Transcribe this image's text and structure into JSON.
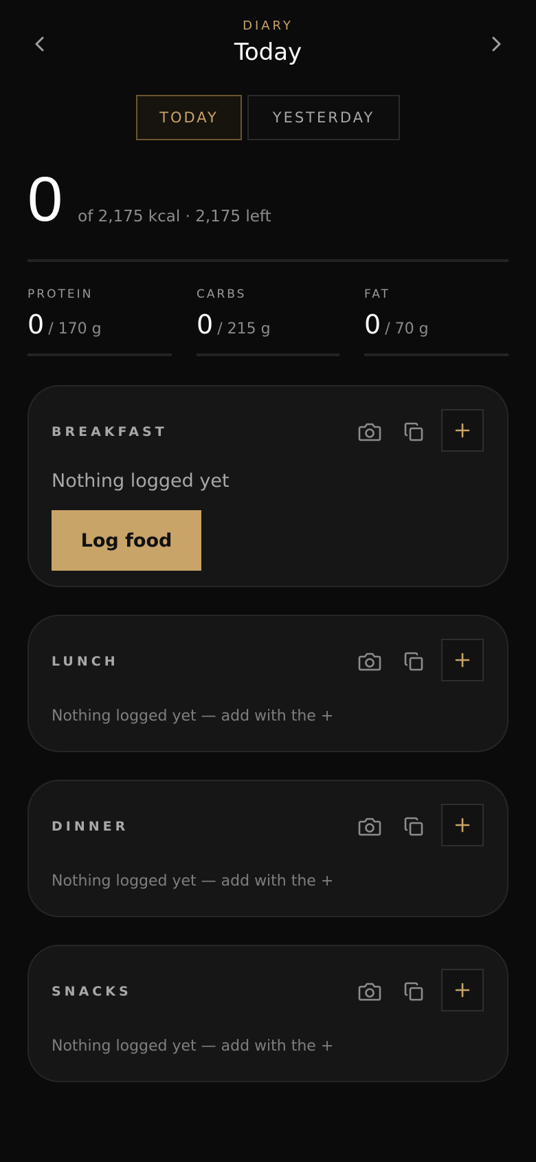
{
  "header": {
    "eyebrow": "DIARY",
    "title": "Today",
    "prev_icon": "chevron-left-icon",
    "next_icon": "chevron-right-icon"
  },
  "day_toggle": {
    "today": "TODAY",
    "yesterday": "YESTERDAY",
    "selected": "TODAY"
  },
  "calories": {
    "consumed": "0",
    "summary": "of 2,175 kcal · 2,175 left",
    "progress": 0
  },
  "macros": [
    {
      "label": "PROTEIN",
      "value": "0",
      "target": "/ 170 g",
      "progress": 0
    },
    {
      "label": "CARBS",
      "value": "0",
      "target": "/ 215 g",
      "progress": 0
    },
    {
      "label": "FAT",
      "value": "0",
      "target": "/ 70 g",
      "progress": 0
    }
  ],
  "meals": [
    {
      "name": "BREAKFAST",
      "empty_text": "Nothing logged yet",
      "action_label": "Log food"
    },
    {
      "name": "LUNCH",
      "empty_text": "Nothing logged yet — add with the +"
    },
    {
      "name": "DINNER",
      "empty_text": "Nothing logged yet — add with the +"
    },
    {
      "name": "SNACKS",
      "empty_text": "Nothing logged yet — add with the +"
    }
  ],
  "meal_icons": {
    "camera": "camera-icon",
    "copy": "copy-icon",
    "add": "plus-icon"
  },
  "colors": {
    "accent": "#c8a468",
    "background": "#0b0b0b",
    "card": "#161616"
  }
}
